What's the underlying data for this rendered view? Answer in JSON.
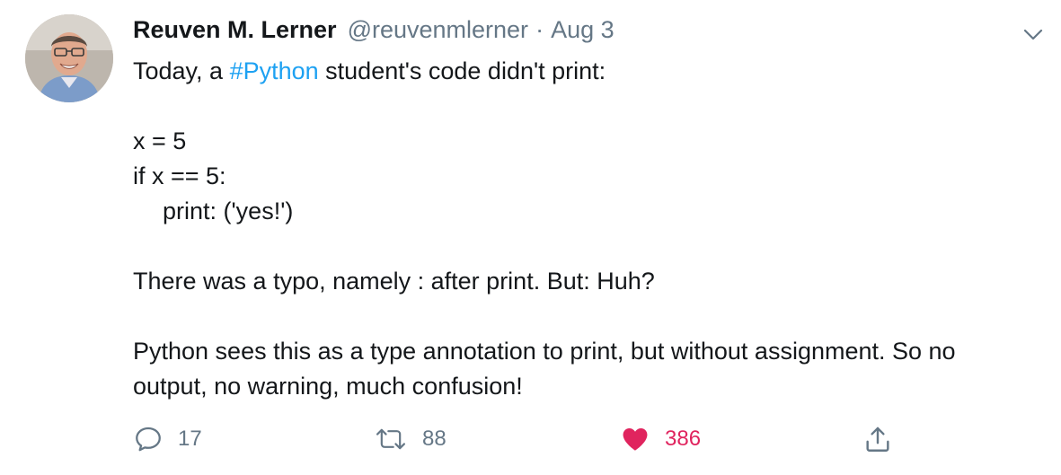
{
  "tweet": {
    "author_name": "Reuven M. Lerner",
    "handle": "@reuvenmlerner",
    "separator": "·",
    "date": "Aug 3",
    "lines": {
      "l1_pre": "Today, a ",
      "l1_hashtag": "#Python",
      "l1_post": " student's code didn't print:",
      "code1": "x = 5",
      "code2": "if x == 5:",
      "code3": "print: ('yes!')",
      "l3": "There was a typo, namely : after print. But: Huh?",
      "l4a": "Python sees this as a type annotation to print, but without assignment. So no",
      "l4b": "output, no warning, much confusion!"
    }
  },
  "actions": {
    "reply_count": "17",
    "retweet_count": "88",
    "like_count": "386",
    "liked": true
  },
  "icons": {
    "menu": "chevron-down-icon",
    "reply": "reply-icon",
    "retweet": "retweet-icon",
    "like": "heart-icon",
    "share": "share-icon"
  },
  "colors": {
    "link": "#1da1f2",
    "muted": "#657786",
    "like": "#e0245e",
    "text": "#14171a"
  }
}
